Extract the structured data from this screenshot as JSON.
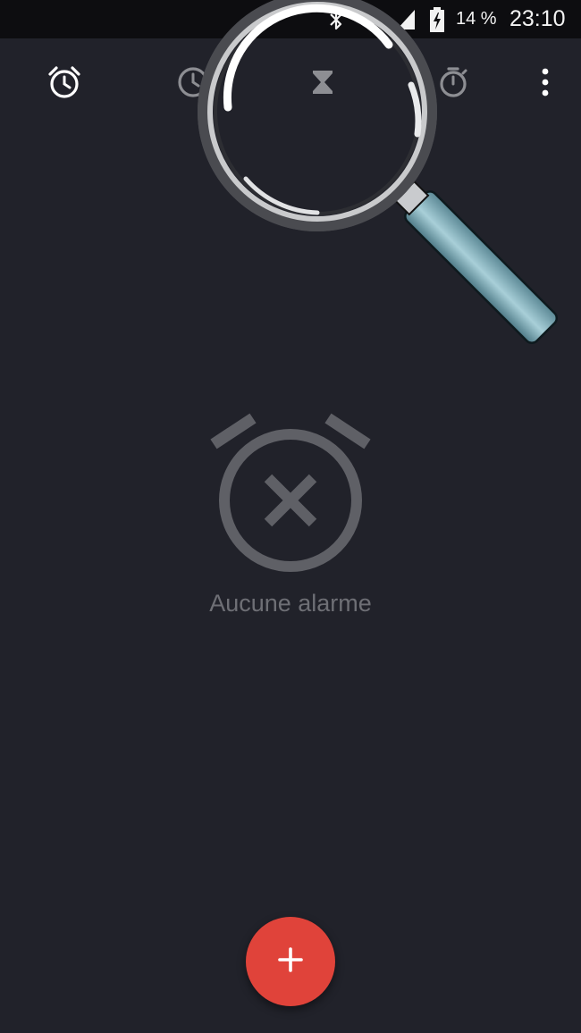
{
  "status_bar": {
    "battery_percent": "14 %",
    "time": "23:10",
    "icons": [
      "bluetooth-icon",
      "wifi-icon",
      "signal-icon",
      "battery-charging-icon"
    ]
  },
  "toolbar": {
    "tabs": [
      {
        "name": "alarm-tab",
        "icon": "alarm-clock-icon",
        "active": true
      },
      {
        "name": "clock-tab",
        "icon": "clock-icon",
        "active": false
      },
      {
        "name": "timer-tab",
        "icon": "hourglass-icon",
        "active": false
      },
      {
        "name": "stopwatch-tab",
        "icon": "stopwatch-icon",
        "active": false
      }
    ],
    "menu_icon": "more-vert-icon"
  },
  "empty_state": {
    "icon": "alarm-off-icon",
    "message": "Aucune alarme"
  },
  "fab": {
    "icon": "plus-icon",
    "label": "+"
  },
  "colors": {
    "background": "#21222a",
    "status_bar": "#0d0d10",
    "fab": "#e0433a",
    "empty_icon": "#5f6066",
    "empty_text": "#6e6f75",
    "magnifier_handle": "#7aa7b4"
  }
}
